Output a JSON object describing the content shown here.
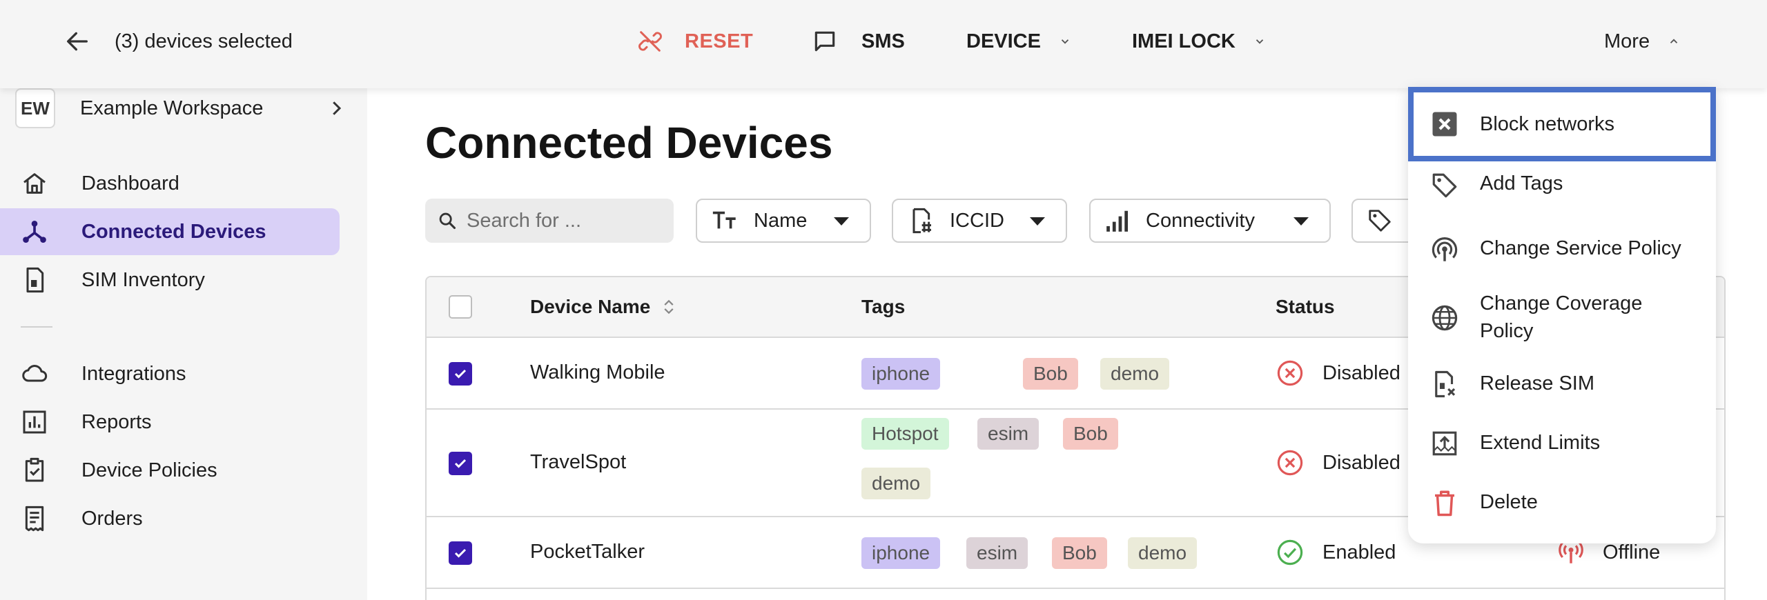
{
  "topbar": {
    "selected_text": "(3) devices selected",
    "reset_label": "RESET",
    "sms_label": "SMS",
    "device_label": "DEVICE",
    "imei_lock_label": "IMEI LOCK",
    "more_label": "More"
  },
  "sidebar": {
    "workspace_badge": "EW",
    "workspace_name": "Example Workspace",
    "items": [
      {
        "label": "Dashboard"
      },
      {
        "label": "Connected Devices"
      },
      {
        "label": "SIM Inventory"
      },
      {
        "label": "Integrations"
      },
      {
        "label": "Reports"
      },
      {
        "label": "Device Policies"
      },
      {
        "label": "Orders"
      }
    ]
  },
  "main": {
    "title": "Connected Devices",
    "search_placeholder": "Search for ...",
    "filters": [
      {
        "label": "Name"
      },
      {
        "label": "ICCID"
      },
      {
        "label": "Connectivity"
      }
    ],
    "table": {
      "headers": {
        "name": "Device Name",
        "tags": "Tags",
        "status": "Status"
      },
      "rows": [
        {
          "name": "Walking Mobile",
          "tags": [
            "iphone",
            "Bob",
            "demo"
          ],
          "status": "Disabled"
        },
        {
          "name": "TravelSpot",
          "tags": [
            "Hotspot",
            "esim",
            "Bob",
            "demo"
          ],
          "status": "Disabled"
        },
        {
          "name": "PocketTalker",
          "tags": [
            "iphone",
            "esim",
            "Bob",
            "demo"
          ],
          "status": "Enabled",
          "connectivity": "Offline"
        }
      ]
    }
  },
  "menu": {
    "items": [
      {
        "label": "Block networks"
      },
      {
        "label": "Add Tags"
      },
      {
        "label": "Change Service Policy"
      },
      {
        "label": "Change Coverage Policy"
      },
      {
        "label": "Release SIM"
      },
      {
        "label": "Extend Limits"
      },
      {
        "label": "Delete"
      }
    ]
  },
  "colors": {
    "accent": "#3a1bb0",
    "active_nav_bg": "#d9d0f7",
    "reset_red": "#e06156",
    "disabled_red": "#e05757",
    "enabled_green": "#4caf50",
    "focus_ring": "#4b72c9",
    "tag_iphone": "#cbc2f4",
    "tag_bob": "#f6c7c2",
    "tag_demo": "#ebebd9",
    "tag_hotspot": "#d3f5d9",
    "tag_esim": "#ddd3d8"
  }
}
